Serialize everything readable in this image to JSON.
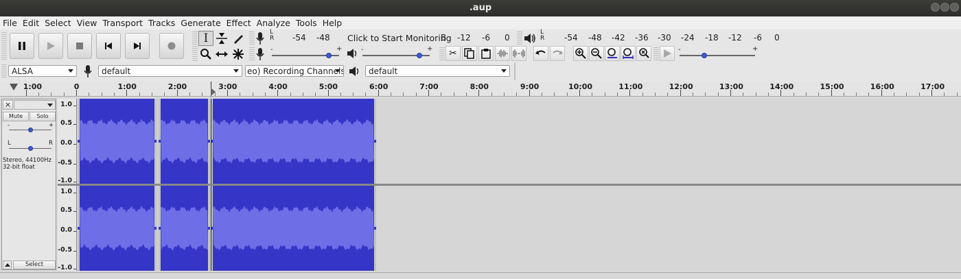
{
  "window": {
    "title": ".aup"
  },
  "menu": [
    "File",
    "Edit",
    "Select",
    "View",
    "Transport",
    "Tracks",
    "Generate",
    "Effect",
    "Analyze",
    "Tools",
    "Help"
  ],
  "transport": {
    "buttons": [
      {
        "name": "pause-button",
        "icon": "pause-icon"
      },
      {
        "name": "play-button",
        "icon": "play-icon"
      },
      {
        "name": "stop-button",
        "icon": "stop-icon"
      },
      {
        "name": "skip-to-start-button",
        "icon": "skip-start-icon"
      },
      {
        "name": "skip-to-end-button",
        "icon": "skip-end-icon"
      },
      {
        "name": "record-button",
        "icon": "record-icon"
      }
    ]
  },
  "recording_meter": {
    "lr_label_l": "L",
    "lr_label_r": "R",
    "scale": [
      "-54",
      "-48",
      "-12",
      "-6",
      "0"
    ],
    "scale_edge": "B",
    "prompt": "Click to Start Monitoring"
  },
  "playback_meter": {
    "lr_label_l": "L",
    "lr_label_r": "R",
    "scale": [
      "-54",
      "-48",
      "-42",
      "-36",
      "-30",
      "-24",
      "-18",
      "-12",
      "-6",
      "0"
    ]
  },
  "mixer": {
    "recording_volume": 0.85,
    "playback_volume": 0.85,
    "minus": "-",
    "plus": "+"
  },
  "play_at_speed": {
    "minus": "-",
    "plus": "+",
    "speed": 0.33
  },
  "device_toolbar": {
    "host": "ALSA",
    "recording_device": "default",
    "recording_channels": "eo) Recording Channels",
    "playback_device": "default"
  },
  "timeline": {
    "labels": [
      "1:00",
      "0",
      "1:00",
      "2:00",
      "3:00",
      "4:00",
      "5:00",
      "6:00",
      "7:00",
      "8:00",
      "9:00",
      "10:00",
      "11:00",
      "12:00",
      "13:00",
      "14:00",
      "15:00",
      "16:00",
      "17:00"
    ]
  },
  "track": {
    "close": "×",
    "mute_label": "Mute",
    "solo_label": "Solo",
    "gain_minus": "-",
    "gain_plus": "+",
    "pan_left": "L",
    "pan_right": "R",
    "info_line1": "Stereo, 44100Hz",
    "info_line2": "32-bit float",
    "select_label": "Select",
    "scale": [
      "1.0",
      "0.5",
      "0.0",
      "-0.5",
      "-1.0"
    ]
  },
  "colors": {
    "waveform_dark": "#3535c8",
    "waveform_light": "#6e6ee6",
    "clip_edge": "#c4c4c4",
    "selection_bg": "#d0d0d0"
  }
}
